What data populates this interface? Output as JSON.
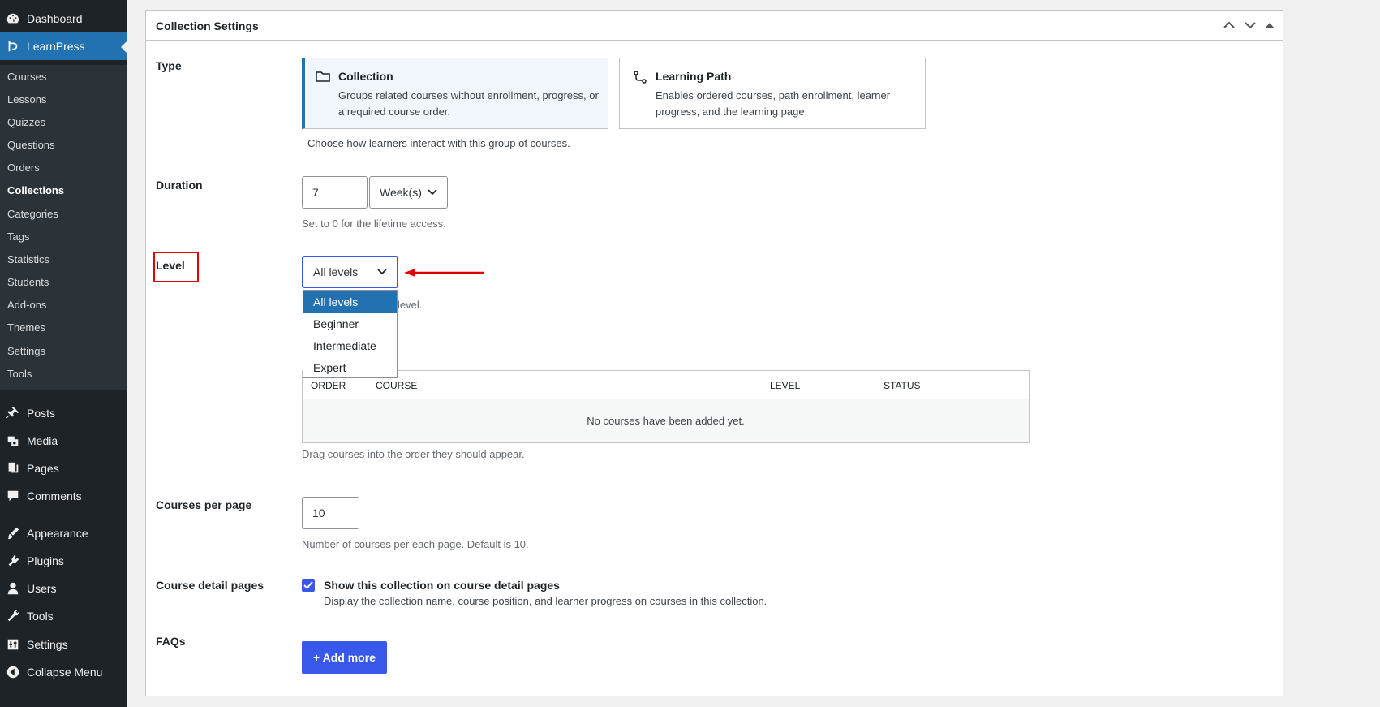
{
  "sidebar": {
    "top_items": [
      {
        "label": "Dashboard",
        "icon": "dashboard-icon"
      },
      {
        "label": "LearnPress",
        "icon": "learnpress-icon",
        "current": true
      }
    ],
    "submenu": [
      {
        "label": "Courses"
      },
      {
        "label": "Lessons"
      },
      {
        "label": "Quizzes"
      },
      {
        "label": "Questions"
      },
      {
        "label": "Orders"
      },
      {
        "label": "Collections",
        "current": true
      },
      {
        "label": "Categories"
      },
      {
        "label": "Tags"
      },
      {
        "label": "Statistics"
      },
      {
        "label": "Students"
      },
      {
        "label": "Add-ons"
      },
      {
        "label": "Themes"
      },
      {
        "label": "Settings"
      },
      {
        "label": "Tools"
      }
    ],
    "bottom_items": [
      {
        "label": "Posts",
        "icon": "pin-icon"
      },
      {
        "label": "Media",
        "icon": "media-icon"
      },
      {
        "label": "Pages",
        "icon": "pages-icon"
      },
      {
        "label": "Comments",
        "icon": "comments-icon"
      },
      {
        "label": "Appearance",
        "icon": "appearance-icon"
      },
      {
        "label": "Plugins",
        "icon": "plugins-icon"
      },
      {
        "label": "Users",
        "icon": "users-icon"
      },
      {
        "label": "Tools",
        "icon": "tools-icon"
      },
      {
        "label": "Settings",
        "icon": "settings-icon"
      },
      {
        "label": "Collapse Menu",
        "icon": "collapse-icon"
      }
    ]
  },
  "metabox": {
    "title": "Collection Settings"
  },
  "type": {
    "label": "Type",
    "options": [
      {
        "title": "Collection",
        "description": "Groups related courses without enrollment, progress, or a required course order.",
        "icon": "folder-icon",
        "selected": true
      },
      {
        "title": "Learning Path",
        "description": "Enables ordered courses, path enrollment, learner progress, and the learning page.",
        "icon": "route-icon",
        "selected": false
      }
    ],
    "help": "Choose how learners interact with this group of courses."
  },
  "duration": {
    "label": "Duration",
    "value": "7",
    "unit": "Week(s)",
    "help": "Set to 0 for the lifetime access."
  },
  "level": {
    "label": "Level",
    "selected": "All levels",
    "options": [
      "All levels",
      "Beginner",
      "Intermediate",
      "Expert"
    ],
    "help_visible": "level."
  },
  "courses_table": {
    "columns": [
      "ORDER",
      "COURSE",
      "LEVEL",
      "STATUS"
    ],
    "empty_text": "No courses have been added yet.",
    "help": "Drag courses into the order they should appear."
  },
  "courses_per_page": {
    "label": "Courses per page",
    "value": "10",
    "help": "Number of courses per each page. Default is 10."
  },
  "course_detail": {
    "label": "Course detail pages",
    "checkbox_label": "Show this collection on course detail pages",
    "checked": true,
    "help": "Display the collection name, course position, and learner progress on courses in this collection."
  },
  "faqs": {
    "label": "FAQs",
    "button": "+ Add more"
  },
  "colors": {
    "sidebar_bg": "#1d2327",
    "accent": "#2271b1",
    "primary_button": "#3858e9",
    "annotation_red": "#e00000"
  }
}
